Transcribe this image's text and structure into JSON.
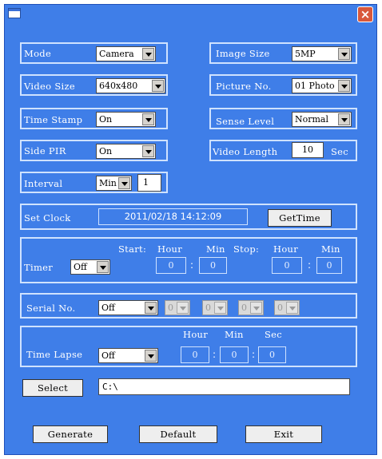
{
  "window": {
    "close_glyph": "×",
    "icon": "app-window-icon"
  },
  "mode": {
    "label": "Mode",
    "value": "Camera"
  },
  "image_size": {
    "label": "Image Size",
    "value": "5MP"
  },
  "video_size": {
    "label": "Video Size",
    "value": "640x480"
  },
  "picture_no": {
    "label": "Picture No.",
    "value": "01 Photo"
  },
  "time_stamp": {
    "label": "Time Stamp",
    "value": "On"
  },
  "sense_level": {
    "label": "Sense Level",
    "value": "Normal"
  },
  "side_pir": {
    "label": "Side PIR",
    "value": "On"
  },
  "video_length": {
    "label": "Video Length",
    "value": "10",
    "unit": "Sec"
  },
  "interval": {
    "label": "Interval",
    "unit_value": "Min",
    "value": "1"
  },
  "set_clock": {
    "label": "Set Clock",
    "datetime": "2011/02/18 14:12:09",
    "button": "GetTime"
  },
  "timer": {
    "label": "Timer",
    "value": "Off",
    "start_label": "Start:",
    "stop_label": "Stop:",
    "hour_label": "Hour",
    "min_label": "Min",
    "start_hour": "0",
    "start_min": "0",
    "stop_hour": "0",
    "stop_min": "0"
  },
  "serial": {
    "label": "Serial No.",
    "value": "Off",
    "digits": [
      "0",
      "0",
      "0",
      "0"
    ]
  },
  "time_lapse": {
    "label": "Time Lapse",
    "value": "Off",
    "hour_label": "Hour",
    "min_label": "Min",
    "sec_label": "Sec",
    "hour": "0",
    "min": "0",
    "sec": "0"
  },
  "select": {
    "button": "Select",
    "path": "C:\\"
  },
  "actions": {
    "generate": "Generate",
    "default": "Default",
    "exit": "Exit"
  },
  "colors": {
    "window_bg": "#3f7ee8",
    "group_border": "#cfe2ff",
    "close": "#d8583b"
  }
}
